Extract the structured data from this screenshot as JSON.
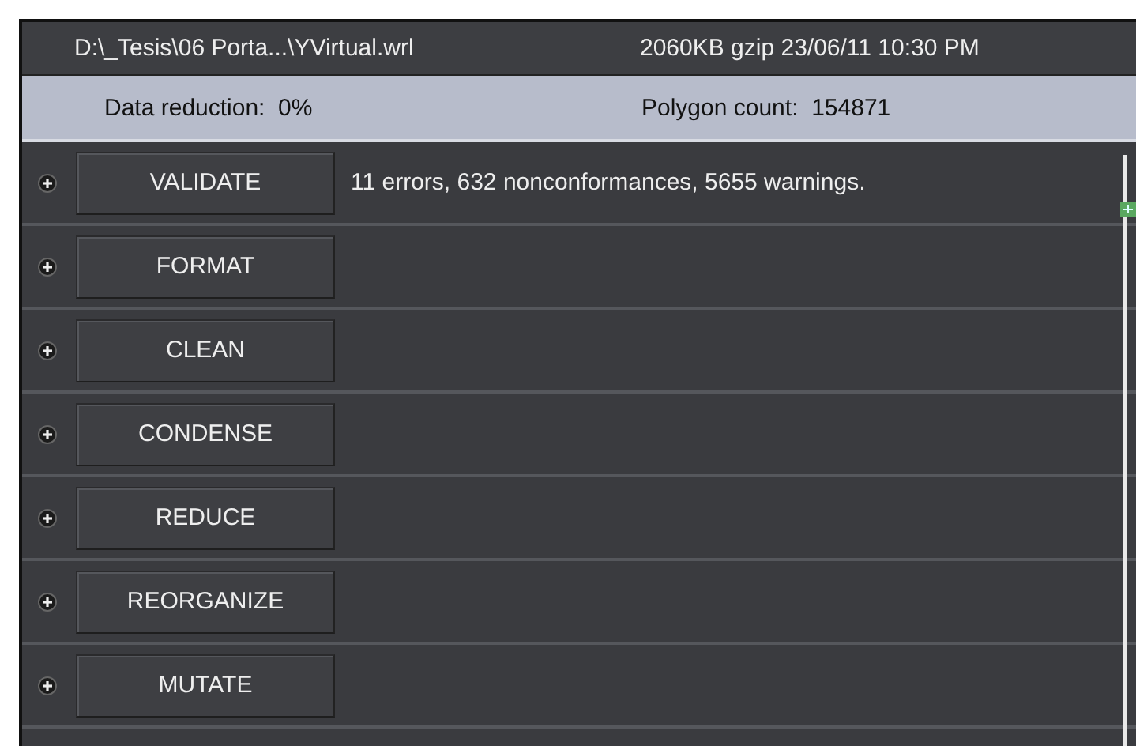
{
  "header": {
    "file_path": "D:\\_Tesis\\06 Porta...\\YVirtual.wrl",
    "file_info": "2060KB gzip 23/06/11 10:30 PM"
  },
  "stats": {
    "data_reduction": "Data reduction:  0%",
    "polygon_count": "Polygon count:  154871"
  },
  "actions": [
    {
      "label": "VALIDATE",
      "expanded": false,
      "result": "11 errors, 632 nonconformances, 5655 warnings."
    },
    {
      "label": "FORMAT",
      "expanded": false
    },
    {
      "label": "CLEAN",
      "expanded": false
    },
    {
      "label": "CONDENSE",
      "expanded": false
    },
    {
      "label": "REDUCE",
      "expanded": false
    },
    {
      "label": "REORGANIZE",
      "expanded": false
    },
    {
      "label": "MUTATE",
      "expanded": false
    }
  ]
}
